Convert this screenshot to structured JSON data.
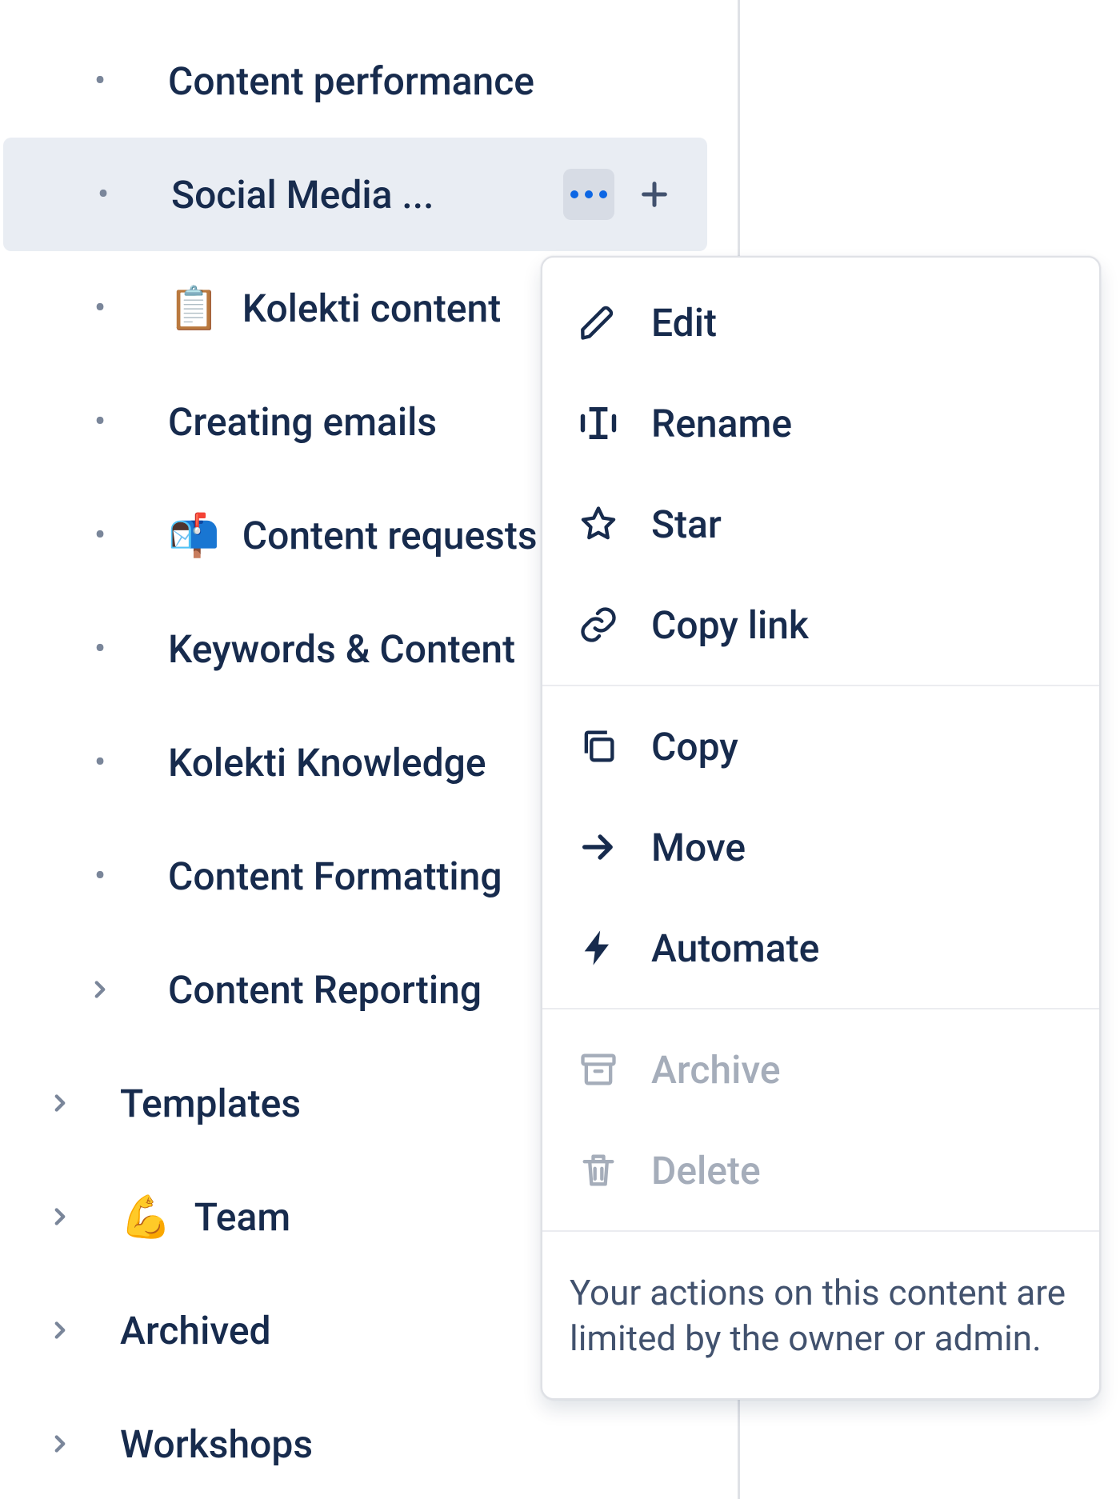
{
  "sidebar": {
    "items": [
      {
        "label": "Content performance",
        "icon": "",
        "indent": 1,
        "marker": "bullet",
        "selected": false
      },
      {
        "label": "Social Media ...",
        "icon": "",
        "indent": 1,
        "marker": "bullet",
        "selected": true,
        "show_more": true,
        "show_add": true
      },
      {
        "label": "Kolekti content",
        "icon": "📋",
        "indent": 1,
        "marker": "bullet",
        "selected": false
      },
      {
        "label": "Creating emails",
        "icon": "",
        "indent": 1,
        "marker": "bullet",
        "selected": false
      },
      {
        "label": "Content requests",
        "icon": "📬",
        "indent": 1,
        "marker": "bullet",
        "selected": false
      },
      {
        "label": "Keywords & Content",
        "icon": "",
        "indent": 1,
        "marker": "bullet",
        "selected": false
      },
      {
        "label": "Kolekti Knowledge",
        "icon": "",
        "indent": 1,
        "marker": "bullet",
        "selected": false
      },
      {
        "label": "Content Formatting",
        "icon": "",
        "indent": 1,
        "marker": "bullet",
        "selected": false
      },
      {
        "label": "Content Reporting",
        "icon": "",
        "indent": 1,
        "marker": "chevron",
        "selected": false
      },
      {
        "label": "Templates",
        "icon": "",
        "indent": 0,
        "marker": "chevron",
        "selected": false
      },
      {
        "label": "Team",
        "icon": "💪",
        "indent": 0,
        "marker": "chevron",
        "selected": false
      },
      {
        "label": "Archived",
        "icon": "",
        "indent": 0,
        "marker": "chevron",
        "selected": false
      },
      {
        "label": "Workshops",
        "icon": "",
        "indent": 0,
        "marker": "chevron",
        "selected": false
      }
    ]
  },
  "menu": {
    "groups": [
      [
        {
          "label": "Edit",
          "icon": "pencil-icon",
          "disabled": false
        },
        {
          "label": "Rename",
          "icon": "rename-icon",
          "disabled": false
        },
        {
          "label": "Star",
          "icon": "star-icon",
          "disabled": false
        },
        {
          "label": "Copy link",
          "icon": "link-icon",
          "disabled": false
        }
      ],
      [
        {
          "label": "Copy",
          "icon": "copy-icon",
          "disabled": false
        },
        {
          "label": "Move",
          "icon": "arrow-right-icon",
          "disabled": false
        },
        {
          "label": "Automate",
          "icon": "bolt-icon",
          "disabled": false
        }
      ],
      [
        {
          "label": "Archive",
          "icon": "archive-icon",
          "disabled": true
        },
        {
          "label": "Delete",
          "icon": "trash-icon",
          "disabled": true
        }
      ]
    ],
    "note": "Your actions on this content are limited by the owner or admin."
  }
}
